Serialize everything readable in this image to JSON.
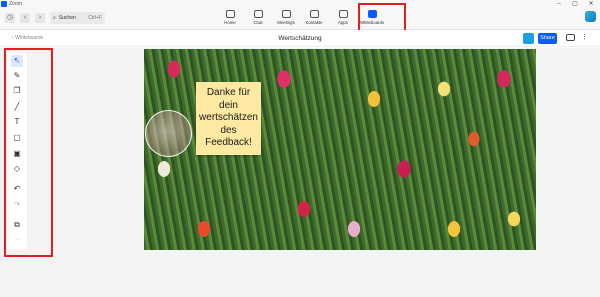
{
  "app": {
    "name": "Zoom"
  },
  "window_controls": {
    "minimize": "–",
    "maximize": "▢",
    "close": "✕"
  },
  "topbar": {
    "search": {
      "label": "Suchen",
      "shortcut": "Ctrl+F"
    },
    "nav": [
      {
        "label": "Home",
        "icon": "home-icon"
      },
      {
        "label": "Chat",
        "icon": "chat-icon"
      },
      {
        "label": "Meetings",
        "icon": "meetings-icon"
      },
      {
        "label": "Kontakte",
        "icon": "contacts-icon"
      },
      {
        "label": "Apps",
        "icon": "apps-icon"
      },
      {
        "label": "Whiteboards",
        "icon": "whiteboards-icon",
        "active": true
      }
    ]
  },
  "subbar": {
    "back_label": "Whiteboards",
    "title": "Wertschätzung",
    "share_label": "Share"
  },
  "toolbar": {
    "tools": [
      {
        "name": "select-tool",
        "glyph": "↖",
        "selected": true
      },
      {
        "name": "pen-tool",
        "glyph": "✎"
      },
      {
        "name": "shapes-tool",
        "glyph": "❐"
      },
      {
        "name": "line-tool",
        "glyph": "╱"
      },
      {
        "name": "text-tool",
        "glyph": "T"
      },
      {
        "name": "sticky-note-tool",
        "glyph": "▢"
      },
      {
        "name": "image-tool",
        "glyph": "▣"
      },
      {
        "name": "eraser-tool",
        "glyph": "◇"
      },
      {
        "name": "undo-tool",
        "glyph": "↶"
      },
      {
        "name": "redo-tool",
        "glyph": "↷"
      },
      {
        "name": "layers-tool",
        "glyph": "⧉"
      },
      {
        "name": "more-tool",
        "glyph": "···"
      }
    ]
  },
  "sticky_note": {
    "text": "Danke für dein wertschätzen des Feedback!"
  },
  "colors": {
    "accent": "#0b5cff",
    "highlight_box": "#e02020",
    "sticky": "#fde9a2"
  }
}
